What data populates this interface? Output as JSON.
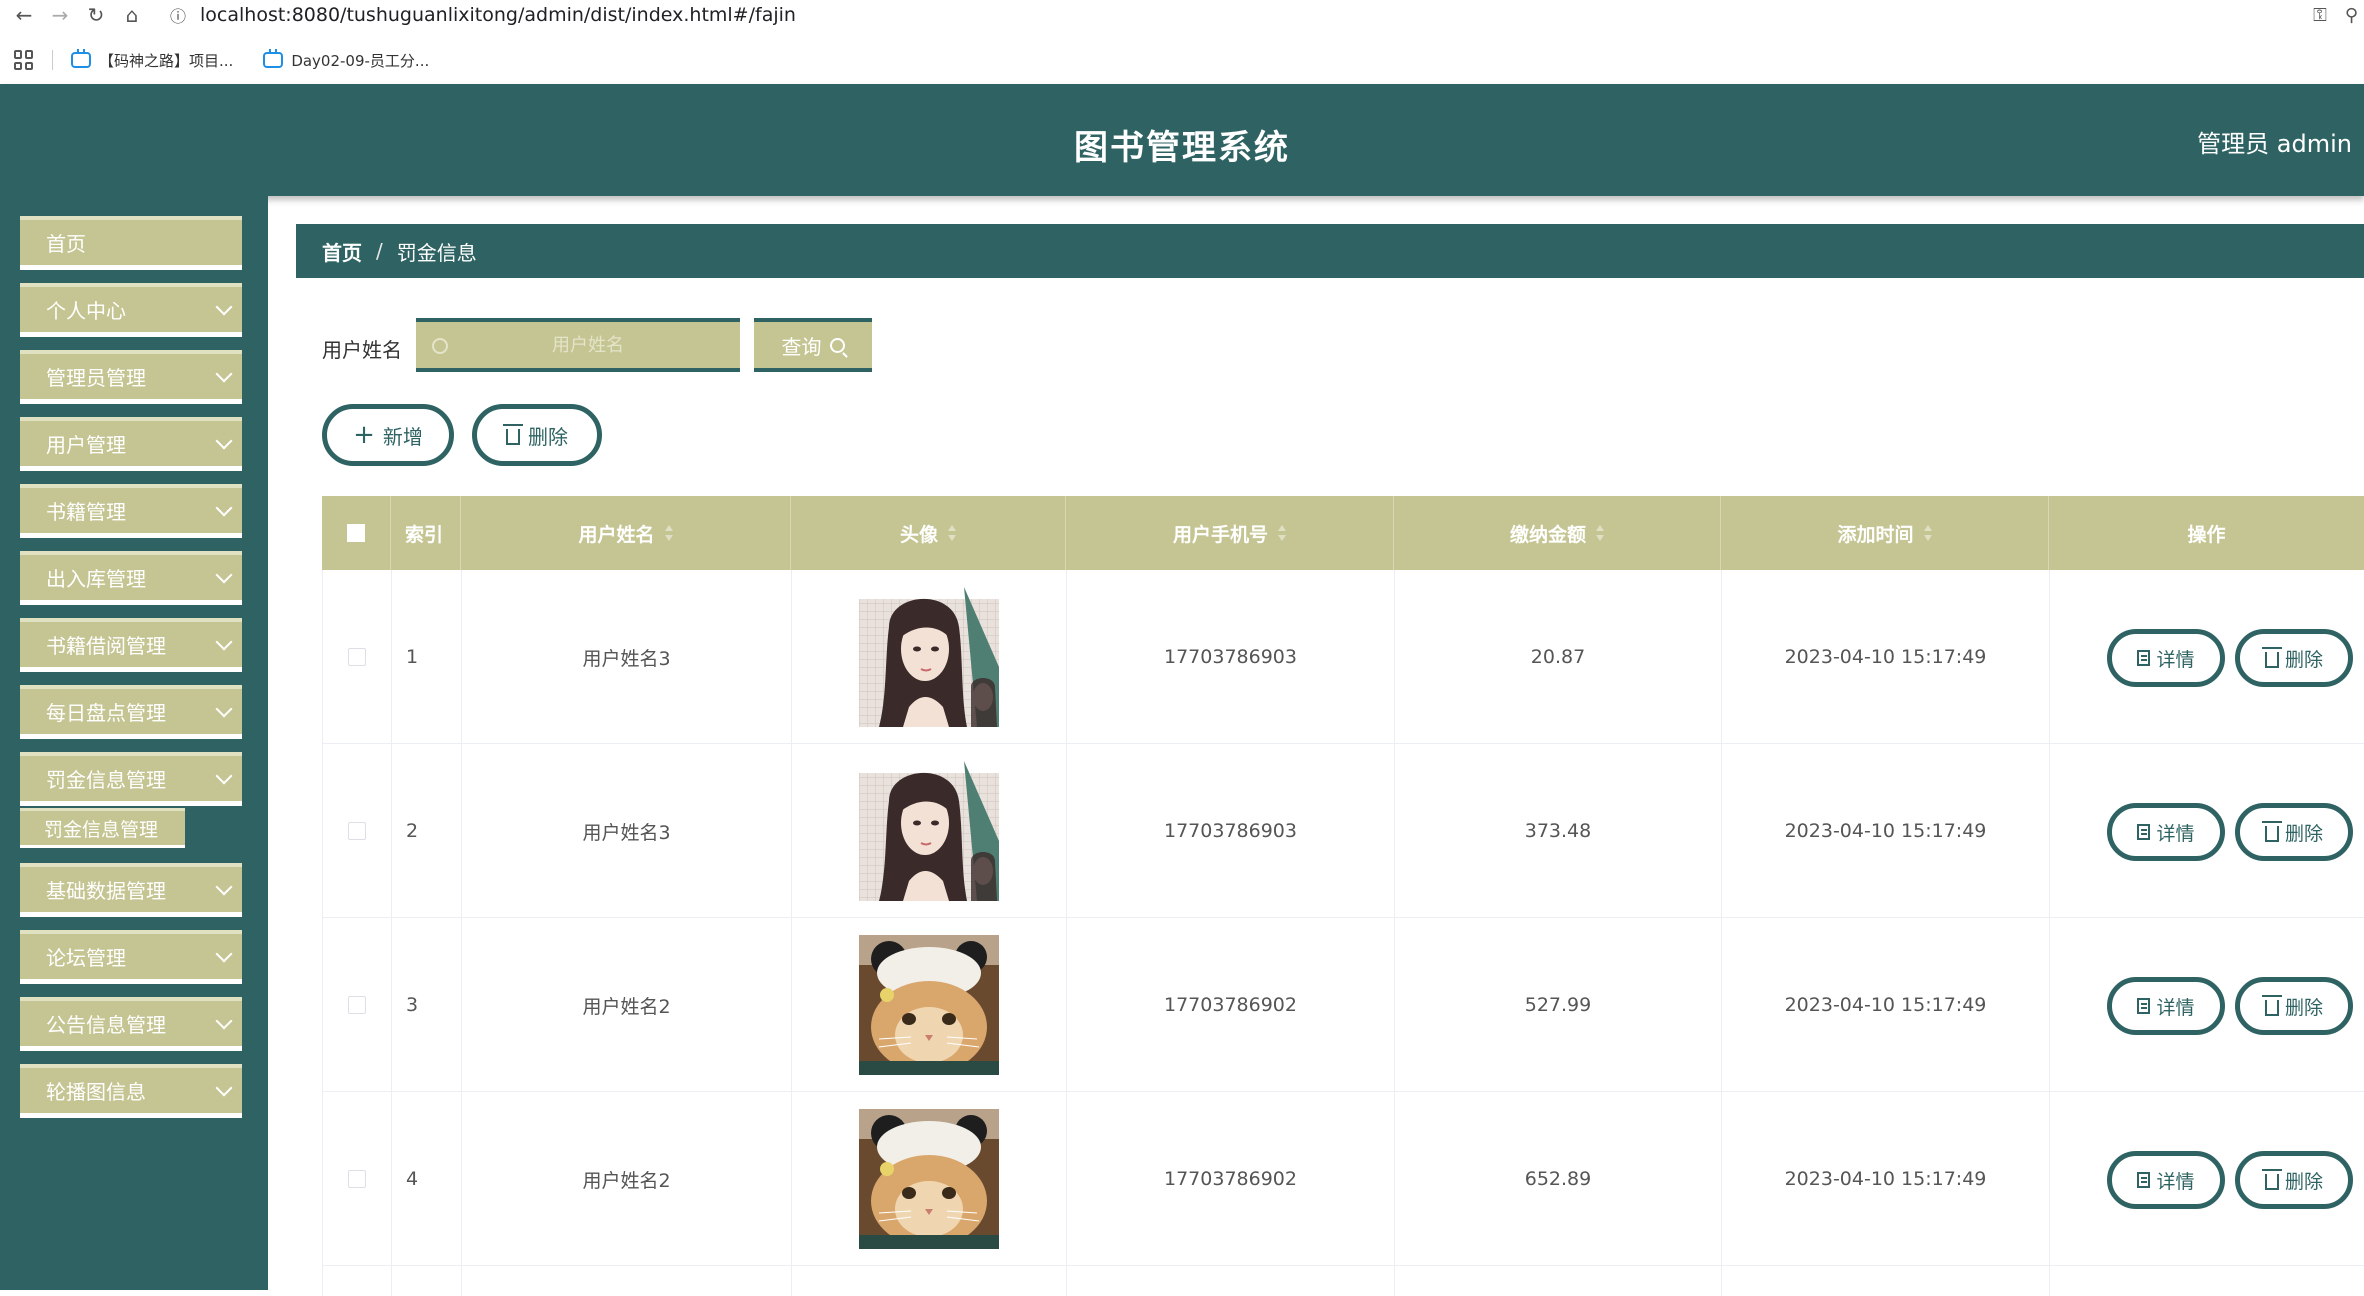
{
  "browser": {
    "url": "localhost:8080/tushuguanlixitong/admin/dist/index.html#/fajin",
    "bookmarks": [
      {
        "label": "【码神之路】项目..."
      },
      {
        "label": "Day02-09-员工分..."
      }
    ]
  },
  "header": {
    "title": "图书管理系统",
    "user": "管理员 admin"
  },
  "sidebar": {
    "items": [
      {
        "label": "首页"
      },
      {
        "label": "个人中心"
      },
      {
        "label": "管理员管理"
      },
      {
        "label": "用户管理"
      },
      {
        "label": "书籍管理"
      },
      {
        "label": "出入库管理"
      },
      {
        "label": "书籍借阅管理"
      },
      {
        "label": "每日盘点管理"
      },
      {
        "label": "罚金信息管理"
      },
      {
        "label": "基础数据管理"
      },
      {
        "label": "论坛管理"
      },
      {
        "label": "公告信息管理"
      },
      {
        "label": "轮播图信息"
      }
    ],
    "active_sub": "罚金信息管理"
  },
  "breadcrumb": {
    "home": "首页",
    "separator": "/",
    "current": "罚金信息"
  },
  "search": {
    "label": "用户姓名",
    "placeholder": "用户姓名",
    "button": "查询"
  },
  "actions": {
    "add": "新增",
    "delete": "删除"
  },
  "table": {
    "columns": {
      "index": "索引",
      "name": "用户姓名",
      "avatar": "头像",
      "phone": "用户手机号",
      "amount": "缴纳金额",
      "time": "添加时间",
      "ops": "操作"
    },
    "rows": [
      {
        "index": "1",
        "name": "用户姓名3",
        "avatar": "woman",
        "phone": "17703786903",
        "amount": "20.87",
        "time": "2023-04-10 15:17:49"
      },
      {
        "index": "2",
        "name": "用户姓名3",
        "avatar": "woman",
        "phone": "17703786903",
        "amount": "373.48",
        "time": "2023-04-10 15:17:49"
      },
      {
        "index": "3",
        "name": "用户姓名2",
        "avatar": "cat",
        "phone": "17703786902",
        "amount": "527.99",
        "time": "2023-04-10 15:17:49"
      },
      {
        "index": "4",
        "name": "用户姓名2",
        "avatar": "cat",
        "phone": "17703786902",
        "amount": "652.89",
        "time": "2023-04-10 15:17:49"
      }
    ],
    "row_detail": "详情",
    "row_delete": "删除"
  },
  "colors": {
    "primary": "#2f6363",
    "accent": "#c5c593"
  }
}
